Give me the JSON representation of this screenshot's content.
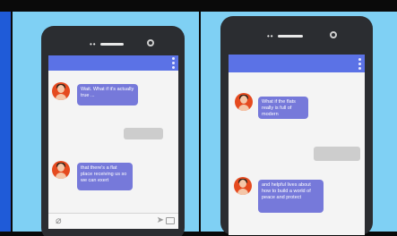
{
  "panels": [
    {
      "messages": [
        {
          "sender": "avatar",
          "text": "Wait. What if it's actually true ..."
        },
        {
          "sender": "me",
          "text": ""
        },
        {
          "sender": "avatar",
          "text": "that there's a flat place receiving us so we can exert"
        }
      ]
    },
    {
      "messages": [
        {
          "sender": "avatar",
          "text": "What if the flats really is full of modern"
        },
        {
          "sender": "me",
          "text": ""
        },
        {
          "sender": "avatar",
          "text": "and helpful lives about how to build a world of peace and protect"
        }
      ]
    }
  ],
  "icons": {
    "attach": "paperclip-icon",
    "send": "send-icon",
    "image": "image-icon",
    "menu": "kebab-menu-icon"
  },
  "colors": {
    "background_left_strip": "#1f5bd8",
    "panel": "#7fd0f4",
    "phone": "#2b2d31",
    "topbar": "#5b72e6",
    "bubble": "#7679da",
    "reply": "#cdcdcd",
    "avatar": "#e54a1f"
  }
}
